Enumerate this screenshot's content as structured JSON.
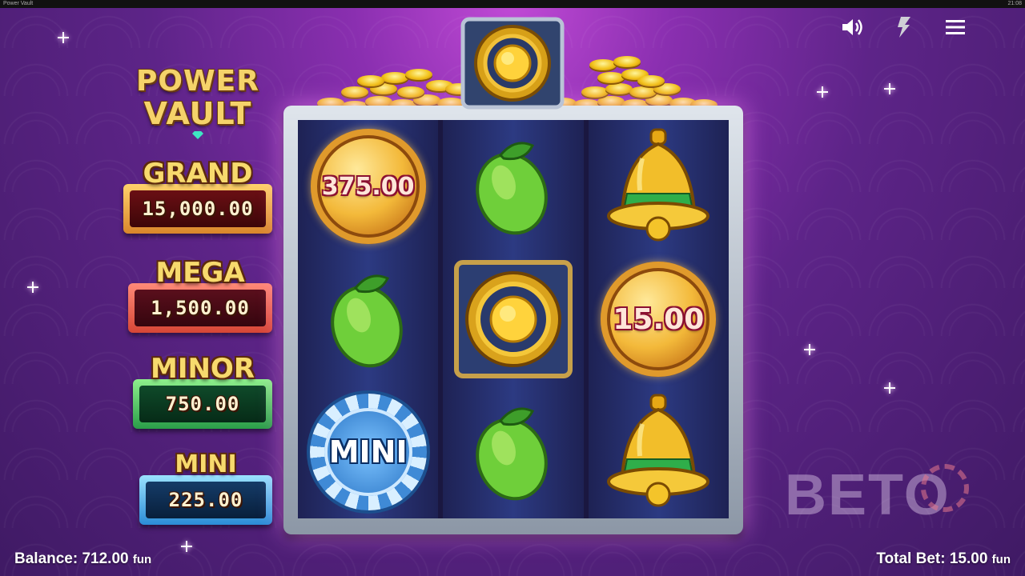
{
  "window": {
    "title": "Power Vault",
    "clock": "21:08"
  },
  "logo": {
    "line1": "POWER",
    "line2": "VAULT"
  },
  "jackpots": {
    "grand": {
      "label": "GRAND",
      "value": "15,000.00"
    },
    "mega": {
      "label": "MEGA",
      "value": "1,500.00"
    },
    "minor": {
      "label": "MINOR",
      "value": "750.00"
    },
    "mini": {
      "label": "MINI",
      "value": "225.00"
    }
  },
  "reels": [
    [
      {
        "symbol": "coin",
        "value": "375.00"
      },
      {
        "symbol": "lime"
      },
      {
        "symbol": "mini-chip",
        "label": "MINI"
      }
    ],
    [
      {
        "symbol": "lime"
      },
      {
        "symbol": "vault"
      },
      {
        "symbol": "lime"
      }
    ],
    [
      {
        "symbol": "bell"
      },
      {
        "symbol": "coin",
        "value": "15.00"
      },
      {
        "symbol": "bell"
      }
    ]
  ],
  "controls": {
    "sound_icon": "speaker-icon",
    "turbo_icon": "lightning-icon",
    "menu_icon": "hamburger-menu-icon"
  },
  "footer": {
    "balance_label": "Balance:",
    "balance_value": "712.00",
    "balance_unit": "fun",
    "bet_label": "Total Bet:",
    "bet_value": "15.00",
    "bet_unit": "fun"
  },
  "watermark": {
    "text": "BETO"
  },
  "colors": {
    "grand": "#d9862b",
    "mega": "#d64636",
    "minor": "#2a9e49",
    "mini": "#2b8cd6"
  }
}
